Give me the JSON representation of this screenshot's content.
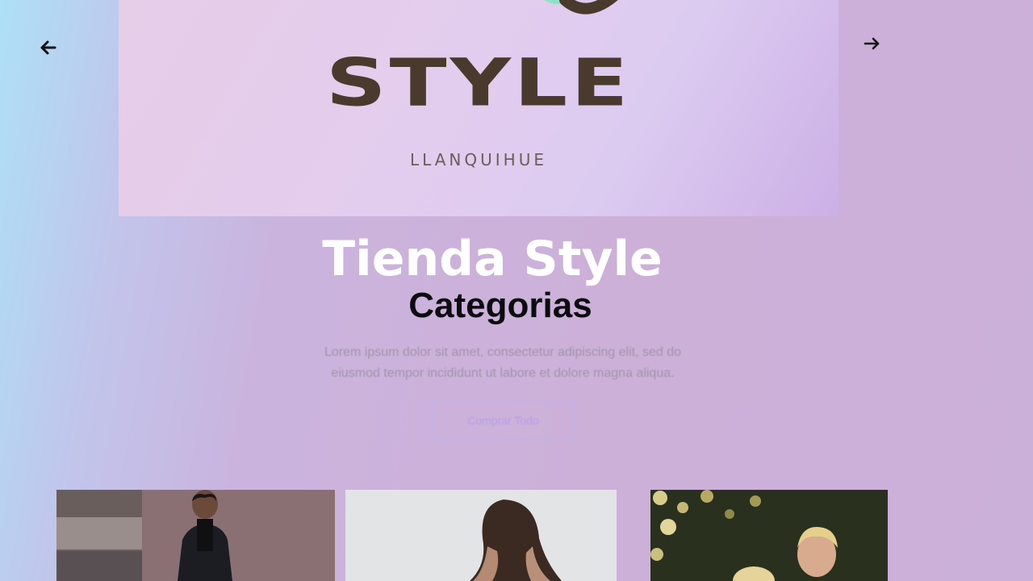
{
  "carousel": {
    "prev_icon": "arrow-left-icon",
    "next_icon": "arrow-right-icon"
  },
  "banner": {
    "logo_text": "STYLE",
    "logo_subtext": "LLANQUIHUE",
    "emblem_icon": "logo-emblem-icon"
  },
  "hero": {
    "title": "Tienda Style",
    "subtitle": "Categorias",
    "description": "Lorem ipsum dolor sit amet, consectetur adipiscing elit, sed do eiusmod tempor incididunt ut labore et dolore magna aliqua.",
    "button_label": "Comprar Todo"
  },
  "colors": {
    "logo_brown": "#4a3a2d",
    "title_white": "#ffffff",
    "subtitle_black": "#0c0c10",
    "button_accent": "#b6a0ea"
  }
}
